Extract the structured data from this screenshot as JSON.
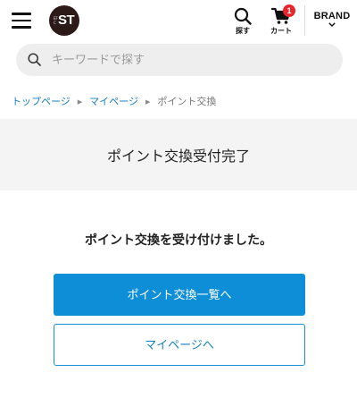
{
  "header": {
    "logo_text": "ST",
    "logo_small_text": "EFC",
    "search_label": "探す",
    "cart_label": "カート",
    "cart_count": "1",
    "brand_label": "BRAND"
  },
  "search": {
    "placeholder": "キーワードで探す"
  },
  "breadcrumb": {
    "items": [
      "トップページ",
      "マイページ",
      "ポイント交換"
    ]
  },
  "page_title": "ポイント交換受付完了",
  "message": "ポイント交換を受け付けました。",
  "buttons": {
    "primary_label": "ポイント交換一覧へ",
    "secondary_label": "マイページへ"
  },
  "colors": {
    "accent": "#0d8ed6",
    "link": "#1a7fc1",
    "badge": "#e8262e",
    "logo_bg": "#2b1a17"
  }
}
